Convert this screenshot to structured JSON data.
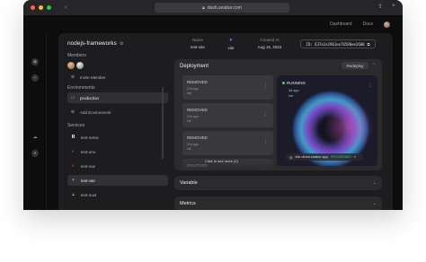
{
  "browser": {
    "url": "dash.zeabur.com",
    "back_icon": "chevron-left-icon",
    "colors": {
      "close": "#ff5f57",
      "minimize": "#febc2e",
      "maximize": "#28c840"
    }
  },
  "topbar": {
    "dashboard": "Dashboard",
    "docs": "Docs"
  },
  "project": {
    "title": "nodejs-frameworks",
    "members_label": "Members",
    "invite_label": "Invite Member",
    "environments_label": "Environments",
    "environments": [
      {
        "label": "production",
        "active": true
      }
    ],
    "add_env_label": "Add Environment",
    "services_label": "Services",
    "services": [
      {
        "label": "test-remix",
        "icon": "R",
        "color": "#ffffff",
        "bg": "transparent",
        "active": false
      },
      {
        "label": "test-umi",
        "icon": "◐",
        "color": "#3b82f6",
        "bg": "transparent",
        "active": false
      },
      {
        "label": "test-vue",
        "icon": "◐",
        "color": "#ef4444",
        "bg": "transparent",
        "active": false
      },
      {
        "label": "test-vite",
        "icon": "▼",
        "color": "#a855f7",
        "bg": "transparent",
        "active": true
      },
      {
        "label": "test-nuxt",
        "icon": "▲",
        "color": "#22c55e",
        "bg": "transparent",
        "active": false
      }
    ]
  },
  "service_info": {
    "name_label": "Name",
    "name_value": "test-vite",
    "framework_value": "vite",
    "created_label": "Created At",
    "created_value": "Aug 16, 2023",
    "id_value": "ID: 637e2e1961ee76588ee2600"
  },
  "deployment": {
    "title": "Deployment",
    "redeploy_label": "Redeploy",
    "history": [
      {
        "status": "REMOVED",
        "time": "21d ago",
        "meta": "init"
      },
      {
        "status": "REMOVED",
        "time": "21d ago",
        "meta": "init"
      },
      {
        "status": "REMOVED",
        "time": "21d ago",
        "meta": "init"
      },
      {
        "status": "REMOVED",
        "time": "",
        "meta": ""
      }
    ],
    "see_more": "Click to see more (1)",
    "current": {
      "status": "RUNNING",
      "time": "3d ago",
      "meta": "init",
      "domain": "vite-demo.zeabur.app",
      "domain_badge": "PROVISIONED"
    }
  },
  "sections": {
    "variable": "Variable",
    "metrics": "Metrics"
  }
}
